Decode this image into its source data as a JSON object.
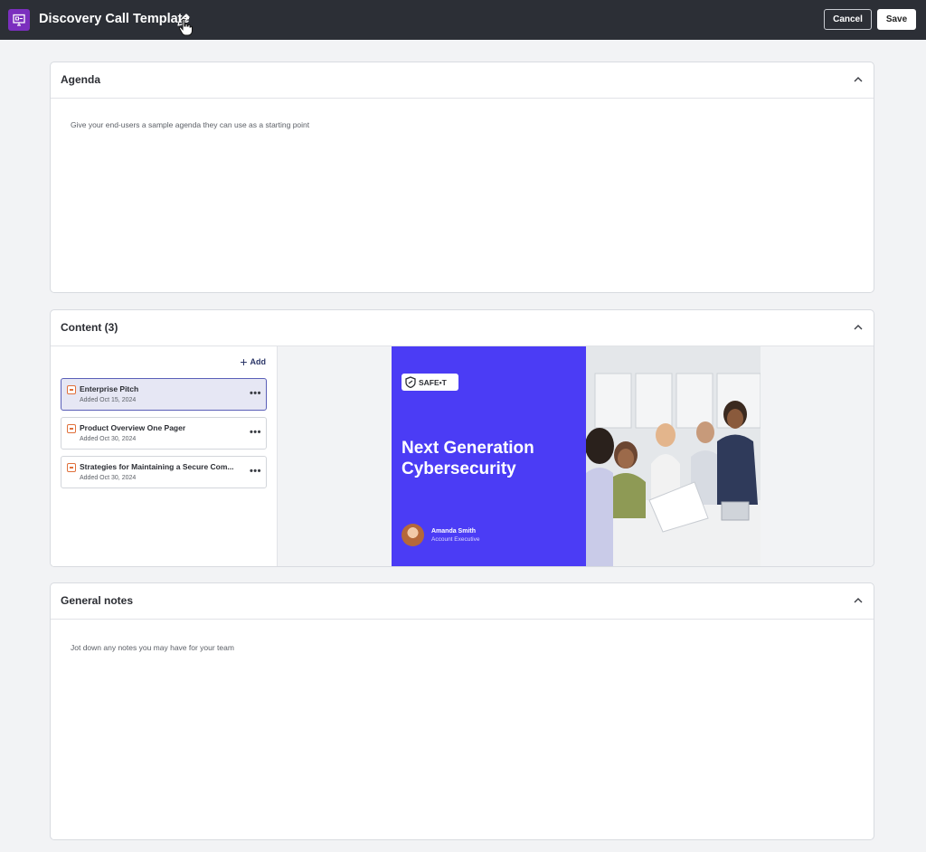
{
  "header": {
    "title": "Discovery Call Template",
    "cancel_label": "Cancel",
    "save_label": "Save"
  },
  "agenda": {
    "title": "Agenda",
    "placeholder": "Give your end-users a sample agenda they can use as a starting point"
  },
  "content": {
    "title": "Content (3)",
    "add_label": "Add",
    "items": [
      {
        "name": "Enterprise Pitch",
        "date": "Added Oct 15, 2024",
        "selected": true
      },
      {
        "name": "Product Overview One Pager",
        "date": "Added Oct 30, 2024",
        "selected": false
      },
      {
        "name": "Strategies for Maintaining a Secure Com...",
        "date": "Added Oct 30, 2024",
        "selected": false
      }
    ],
    "preview": {
      "logo_text": "SAFE•T",
      "headline": "Next Generation Cybersecurity",
      "presenter_name": "Amanda Smith",
      "presenter_role": "Account Executive"
    }
  },
  "notes": {
    "title": "General notes",
    "placeholder": "Jot down any notes you may have for your team"
  },
  "colors": {
    "topbar": "#2c2f36",
    "app_icon": "#7b2fbe",
    "slide_accent": "#4b3cf5",
    "file_icon": "#e0703b",
    "selected_card": "#e6e7f4"
  },
  "icons": [
    "presentation-icon",
    "pencil-icon",
    "hand-cursor-icon",
    "chevron-up-icon",
    "plus-icon",
    "more-icon",
    "shield-icon"
  ]
}
